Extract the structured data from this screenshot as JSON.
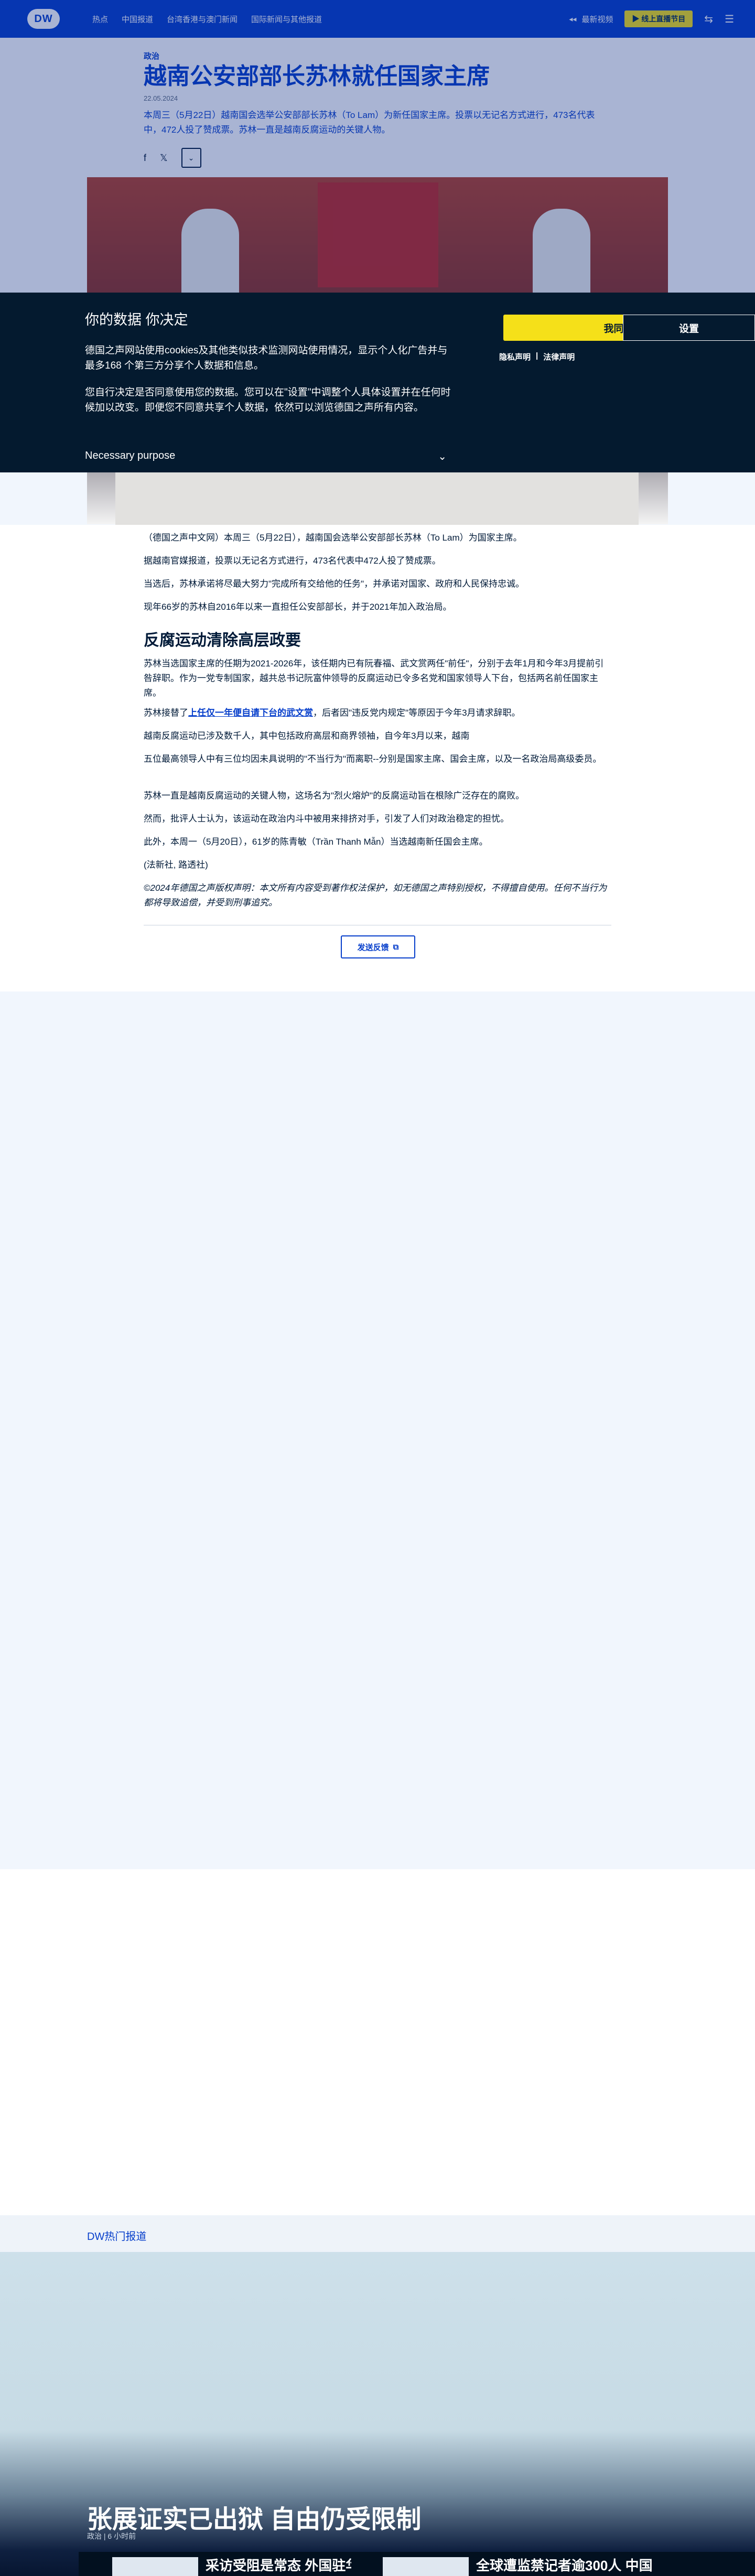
{
  "header": {
    "logo": "DW",
    "nav": [
      "热点",
      "中国报道",
      "台湾香港与澳门新闻",
      "国际新闻与其他报道"
    ],
    "latest_label": "最新视频",
    "live_label": "线上直播节目"
  },
  "article": {
    "category": "政治",
    "headline": "越南公安部部长苏林就任国家主席",
    "date": "22.05.2024",
    "teaser": "本周三（5月22日）越南国会选举公安部部长苏林（To Lam）为新任国家主席。投票以无记名方式进行，473名代表中，472人投了赞成票。苏林一直是越南反腐运动的关键人物。",
    "paragraphs": [
      "（德国之声中文网）本周三（5月22日），越南国会选举公安部部长苏林（To Lam）为国家主席。",
      "据越南官媒报道，投票以无记名方式进行，473名代表中472人投了赞成票。",
      "当选后，苏林承诺将尽最大努力\"完成所有交给他的任务\"，并承诺对国家、政府和人民保持忠诚。",
      "现年66岁的苏林自2016年以来一直担任公安部部长，并于2021年加入政治局。"
    ],
    "section_heading": "反腐运动清除高层政要",
    "paragraphs2": [
      "苏林当选国家主席的任期为2021-2026年，该任期内已有阮春福、武文赏两任\"前任\"，分别于去年1月和今年3月提前引咎辞职。作为一党专制国家，越共总书记阮富仲领导的反腐运动已令多名党和国家领导人下台，包括两名前任国家主席。",
      "越南反腐运动已涉及数千人，其中包括政府高层和商界领袖，自今年3月以来，越南",
      "五位最高领导人中有三位均因未具说明的\"不当行为\"而离职--分别是国家主席、国会主席，以及一名政治局高级委员。",
      "苏林一直是越南反腐运动的关键人物，这场名为\"烈火熔炉\"的反腐运动旨在根除广泛存在的腐败。",
      "然而，批评人士认为，该运动在政治内斗中被用来排挤对手，引发了人们对政治稳定的担忧。",
      "此外，本周一（5月20日），61岁的陈青敏（Trần Thanh Mẫn）当选越南新任国会主席。"
    ],
    "link_prefix": "苏林接替了",
    "link_text": "上任仅一年便自请下台的武文赏",
    "link_suffix": "，后者因\"违反党内规定\"等原因于今年3月请求辞职。",
    "source": "(法新社, 路透社)",
    "copyright": "©2024年德国之声版权声明：本文所有内容受到著作权法保护，如无德国之声特别授权，不得擅自使用。任何不当行为都将导致追偿，并受到刑事追究。",
    "feedback_label": "发送反馈"
  },
  "cookie": {
    "title": "你的数据 你决定",
    "p1": "德国之声网站使用cookies及其他类似技术监测网站使用情况，显示个人化广告并与最多168 个第三方分享个人数据和信息。",
    "p2": "您自行决定是否同意使用您的数据。您可以在\"设置\"中调整个人具体设置并在任何时候加以改变。即便您不同意共享个人数据，依然可以浏览德国之声所有内容。",
    "purpose": "Necessary purpose",
    "accept_label": "我同意",
    "settings_label": "设置",
    "privacy_link": "隐私声明",
    "legal_link": "法律声明"
  },
  "trending": {
    "label": "DW热门报道"
  },
  "feature": {
    "title": "张展证实已出狱 自由仍受限制",
    "meta": "政治 | 6 小时前",
    "cards": [
      "采访受阻是常态 外国驻华记",
      "全球遭监禁记者逾300人 中国"
    ]
  },
  "colors": {
    "brand_blue": "#063ecb",
    "accent_yellow": "#f5e019",
    "dark_navy": "#041a2f"
  }
}
